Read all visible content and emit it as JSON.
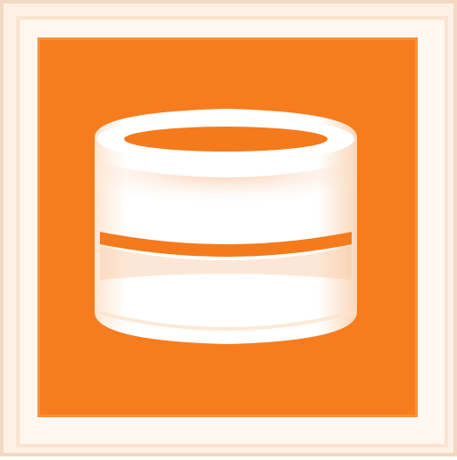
{
  "icon": {
    "name": "database-icon",
    "colors": {
      "frame": "#fdf1e6",
      "tile": "#f77c1e",
      "cylinder": "#ffffff",
      "band": "#f47a1c"
    }
  }
}
